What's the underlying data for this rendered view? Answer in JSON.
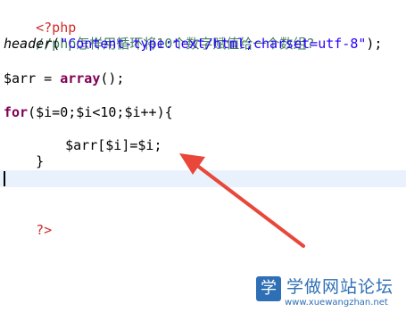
{
  "code": {
    "line1": {
      "tag": "<?php"
    },
    "line2": {
      "comment": "//php怎样用循环将10个数字赋值给一个数组?"
    },
    "line3": {
      "fn": "header",
      "open": "(",
      "str": "\"Content-type:text/html;charset=utf-8\"",
      "close": ");"
    },
    "line5": {
      "var": "$arr = ",
      "kw": "array",
      "rest": "();"
    },
    "line7": {
      "kw": "for",
      "rest": "($i=0;$i<10;$i++){"
    },
    "line8": {
      "text": "$arr[$i]=$i;"
    },
    "line9": {
      "text": "}"
    },
    "line13": {
      "tag": "?>"
    }
  },
  "watermark": {
    "logo": "学",
    "title": "学做网站论坛",
    "url": "www.xuewangzhan.net"
  },
  "colors": {
    "tag": "#d12c2c",
    "comment": "#3f7f5f",
    "string": "#2a00ff",
    "keyword": "#7f0055",
    "current_line": "#e9f2fc",
    "arrow": "#e8473a",
    "watermark": "#2f6fb5"
  }
}
